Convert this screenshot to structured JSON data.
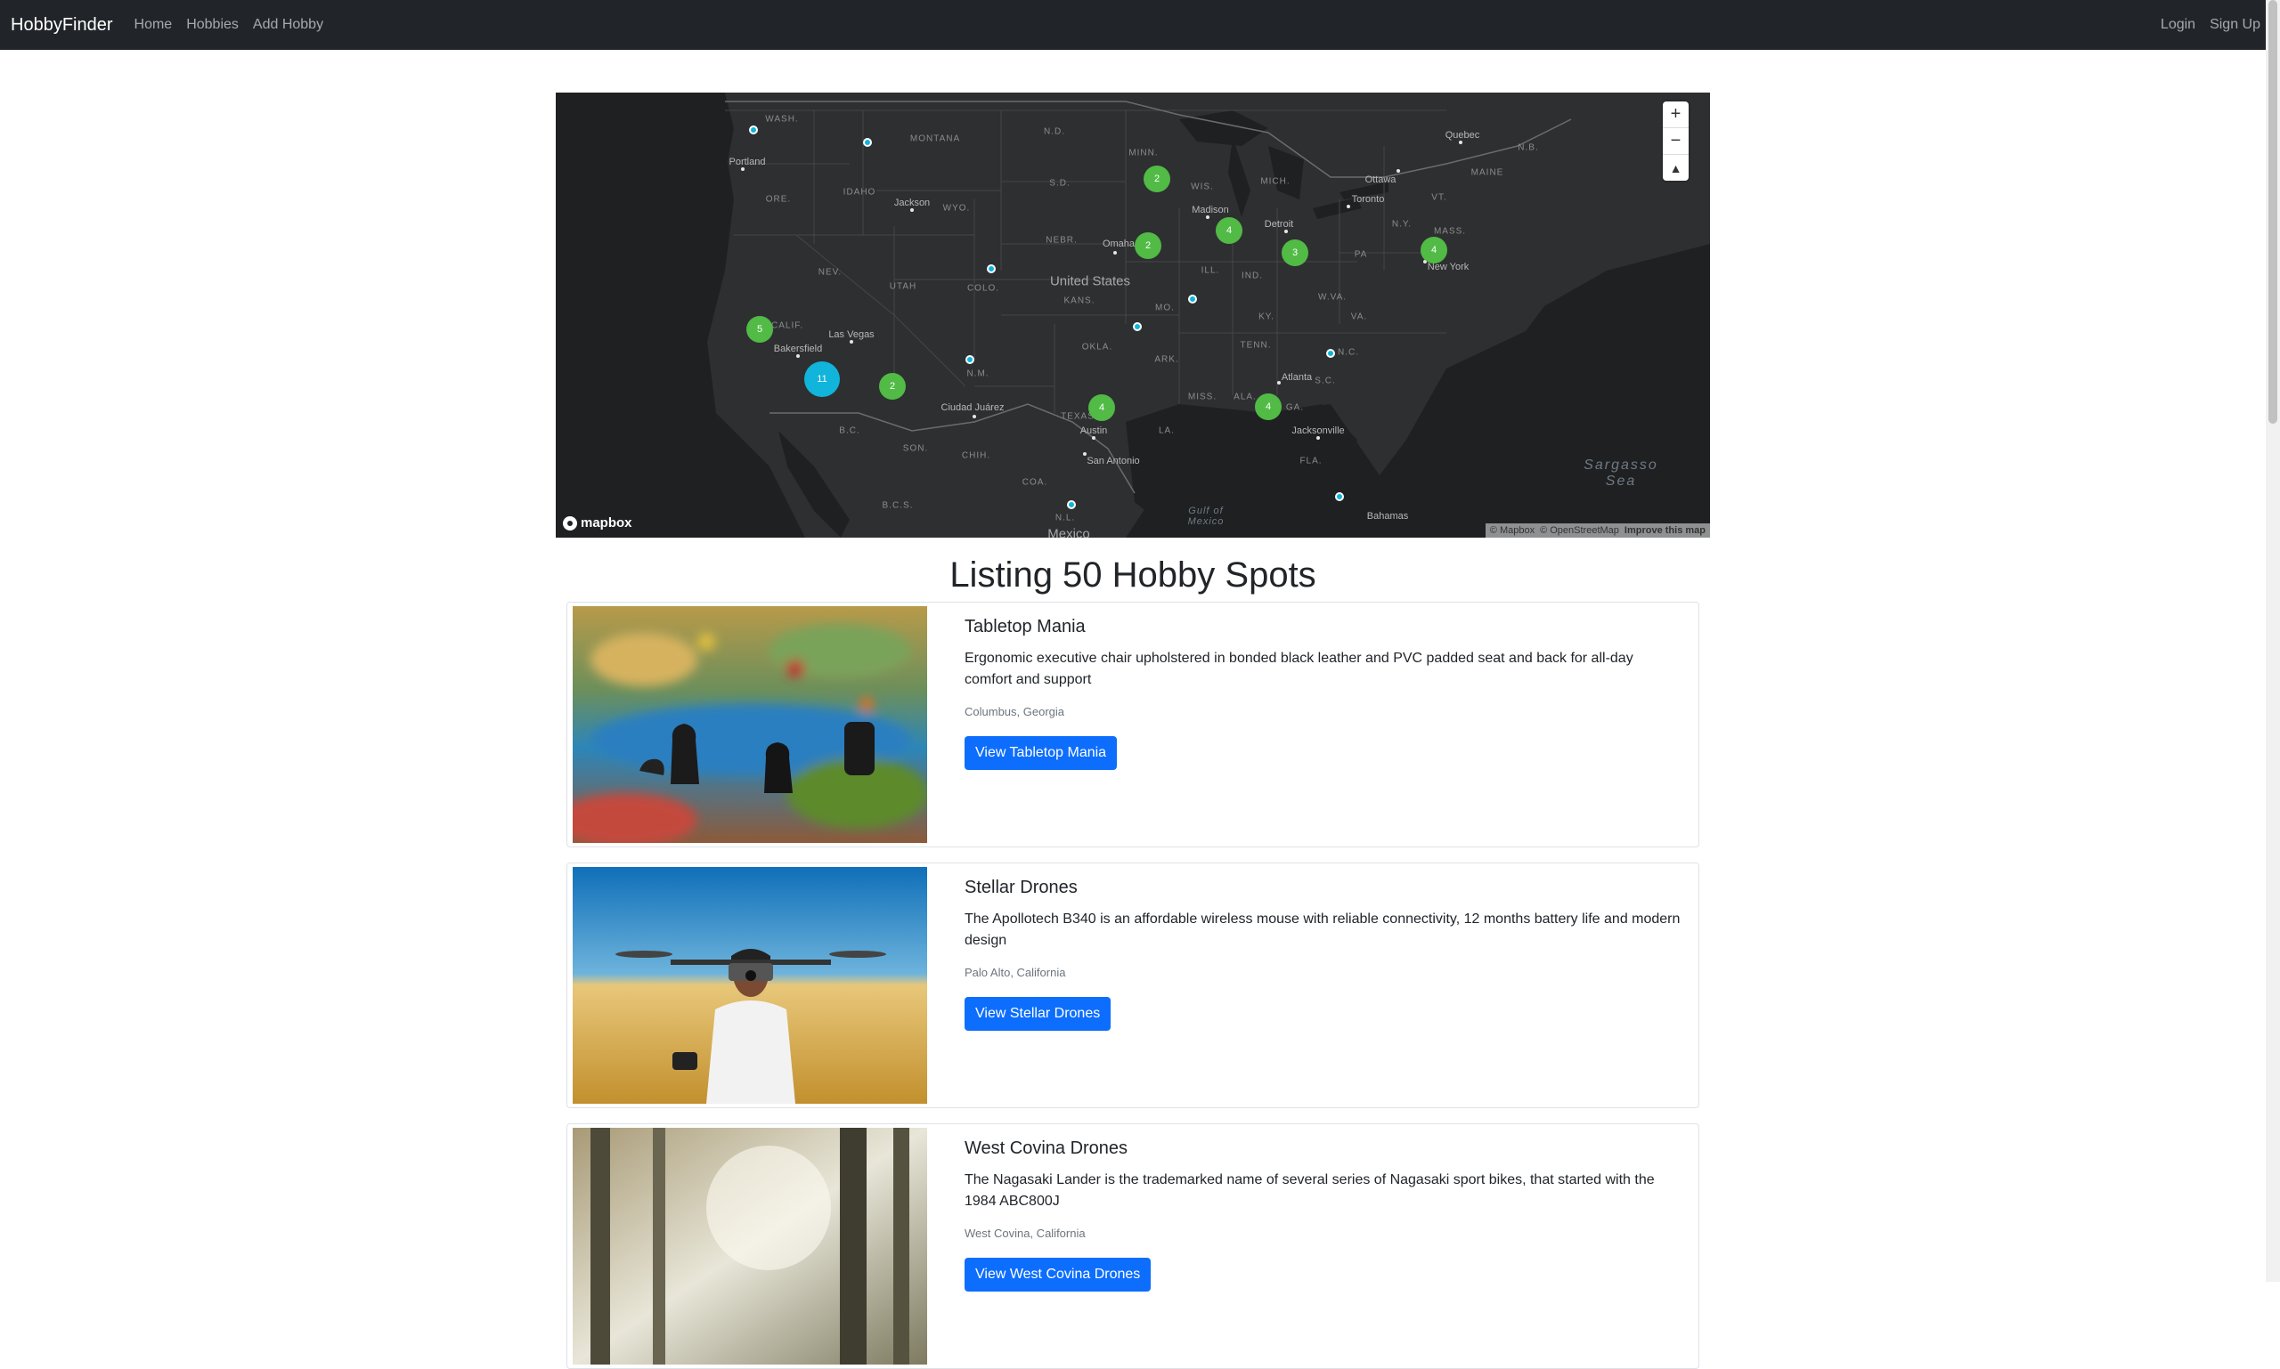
{
  "navbar": {
    "brand": "HobbyFinder",
    "links": [
      "Home",
      "Hobbies",
      "Add Hobby"
    ],
    "right_links": [
      "Login",
      "Sign Up"
    ]
  },
  "map": {
    "labels": {
      "wash": "WASH.",
      "montana": "MONTANA",
      "nd": "N.D.",
      "minn": "MINN.",
      "portland": "Portland",
      "idaho": "IDAHO",
      "ore": "ORE.",
      "jackson": "Jackson",
      "wyo": "WYO.",
      "sd": "S.D.",
      "wis": "WIS.",
      "mich": "MICH.",
      "madison": "Madison",
      "detroit": "Detroit",
      "ottawa": "Ottawa",
      "toronto": "Toronto",
      "quebec": "Quebec",
      "nb": "N.B.",
      "maine": "MAINE",
      "vt": "VT.",
      "ny": "N.Y.",
      "mass": "MASS.",
      "pa": "PA",
      "newyork": "New York",
      "nebr": "NEBR.",
      "omaha": "Omaha",
      "ill": "ILL.",
      "ind": "IND.",
      "us": "United States",
      "nev": "NEV.",
      "utah": "UTAH",
      "colo": "COLO.",
      "kans": "KANS.",
      "mo": "MO.",
      "ky": "KY.",
      "wva": "W.VA.",
      "va": "VA.",
      "calif": "CALIF.",
      "lasvegas": "Las Vegas",
      "bakersfield": "Bakersfield",
      "okla": "OKLA.",
      "ark": "ARK.",
      "tenn": "TENN.",
      "nc": "N.C.",
      "nm": "N.M.",
      "atlanta": "Atlanta",
      "sc": "S.C.",
      "ciudadjuarez": "Ciudad Juárez",
      "texas": "TEXAS",
      "miss": "MISS.",
      "ala": "ALA.",
      "ga": "GA.",
      "austin": "Austin",
      "la": "LA.",
      "jacksonville": "Jacksonville",
      "bc": "B.C.",
      "son": "SON.",
      "chih": "CHIH.",
      "sanantonio": "San Antonio",
      "fla": "FLA.",
      "coa": "COA.",
      "bcs": "B.C.S.",
      "nl": "N.L.",
      "mexico": "Mexico",
      "bahamas": "Bahamas",
      "gulf": "Gulf of Mexico",
      "sea": "Sargasso Sea"
    },
    "clusters": [
      {
        "id": "mn",
        "count": "2"
      },
      {
        "id": "mi",
        "count": "4"
      },
      {
        "id": "ne",
        "count": "2"
      },
      {
        "id": "oh",
        "count": "3"
      },
      {
        "id": "ny",
        "count": "4"
      },
      {
        "id": "ca",
        "count": "5"
      },
      {
        "id": "la",
        "count": "11"
      },
      {
        "id": "az",
        "count": "2"
      },
      {
        "id": "tx",
        "count": "4"
      },
      {
        "id": "ga",
        "count": "4"
      }
    ],
    "controls": {
      "zoom_in": "+",
      "zoom_out": "−",
      "compass": "▲"
    },
    "logo": "mapbox",
    "attribution": [
      "© Mapbox",
      "© OpenStreetMap",
      "Improve this map"
    ]
  },
  "listing_title": "Listing 50 Hobby Spots",
  "cards": [
    {
      "title": "Tabletop Mania",
      "description": "Ergonomic executive chair upholstered in bonded black leather and PVC padded seat and back for all-day comfort and support",
      "location": "Columbus, Georgia",
      "button": "View Tabletop Mania"
    },
    {
      "title": "Stellar Drones",
      "description": "The Apollotech B340 is an affordable wireless mouse with reliable connectivity, 12 months battery life and modern design",
      "location": "Palo Alto, California",
      "button": "View Stellar Drones"
    },
    {
      "title": "West Covina Drones",
      "description": "The Nagasaki Lander is the trademarked name of several series of Nagasaki sport bikes, that started with the 1984 ABC800J",
      "location": "West Covina, California",
      "button": "View West Covina Drones"
    }
  ]
}
